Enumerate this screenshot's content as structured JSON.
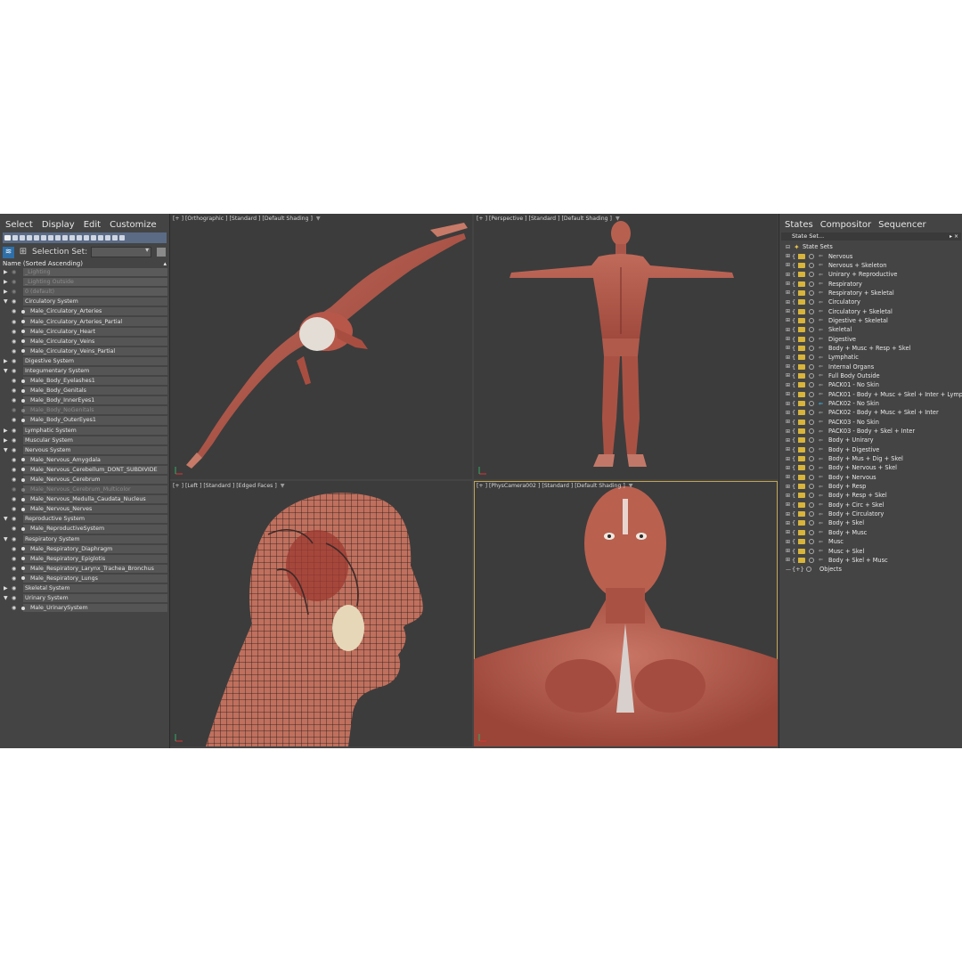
{
  "scene_explorer": {
    "menu": [
      "Select",
      "Display",
      "Edit",
      "Customize"
    ],
    "selection_set_label": "Selection Set:",
    "column_header": "Name (Sorted Ascending)",
    "rows": [
      {
        "label": "_Lighting",
        "kind": "layer",
        "dim": true
      },
      {
        "label": "_Lighting Outside",
        "kind": "layer",
        "dim": true
      },
      {
        "label": "0 (default)",
        "kind": "layer",
        "dim": true
      },
      {
        "label": "Circulatory System",
        "kind": "top"
      },
      {
        "label": "Male_Circulatory_Arteries",
        "kind": "child"
      },
      {
        "label": "Male_Circulatory_Arteries_Partial",
        "kind": "child"
      },
      {
        "label": "Male_Circulatory_Heart",
        "kind": "child"
      },
      {
        "label": "Male_Circulatory_Veins",
        "kind": "child"
      },
      {
        "label": "Male_Circulatory_Veins_Partial",
        "kind": "child"
      },
      {
        "label": "Digestive System",
        "kind": "top",
        "collapsed": true
      },
      {
        "label": "Integumentary System",
        "kind": "top"
      },
      {
        "label": "Male_Body_Eyelashes1",
        "kind": "child"
      },
      {
        "label": "Male_Body_Genitals",
        "kind": "child"
      },
      {
        "label": "Male_Body_InnerEyes1",
        "kind": "child"
      },
      {
        "label": "Male_Body_NoGenitals",
        "kind": "child",
        "dim": true
      },
      {
        "label": "Male_Body_OuterEyes1",
        "kind": "child"
      },
      {
        "label": "Lymphatic System",
        "kind": "top",
        "collapsed": true
      },
      {
        "label": "Muscular System",
        "kind": "top",
        "collapsed": true
      },
      {
        "label": "Nervous System",
        "kind": "top"
      },
      {
        "label": "Male_Nervous_Amygdala",
        "kind": "child"
      },
      {
        "label": "Male_Nervous_Cerebellum_DONT_SUBDIVIDE",
        "kind": "child"
      },
      {
        "label": "Male_Nervous_Cerebrum",
        "kind": "child"
      },
      {
        "label": "Male_Nervous_Cerebrum_Multicolor",
        "kind": "child",
        "dim": true
      },
      {
        "label": "Male_Nervous_Medulla_Caudata_Nucleus",
        "kind": "child"
      },
      {
        "label": "Male_Nervous_Nerves",
        "kind": "child"
      },
      {
        "label": "Reproductive System",
        "kind": "top"
      },
      {
        "label": "Male_ReproductiveSystem",
        "kind": "child"
      },
      {
        "label": "Respiratory System",
        "kind": "top"
      },
      {
        "label": "Male_Respiratory_Diaphragm",
        "kind": "child"
      },
      {
        "label": "Male_Respiratory_Epiglotis",
        "kind": "child"
      },
      {
        "label": "Male_Respiratory_Larynx_Trachea_Bronchus",
        "kind": "child"
      },
      {
        "label": "Male_Respiratory_Lungs",
        "kind": "child"
      },
      {
        "label": "Skeletal System",
        "kind": "top",
        "collapsed": true
      },
      {
        "label": "Urinary System",
        "kind": "top"
      },
      {
        "label": "Male_UrinarySystem",
        "kind": "child"
      }
    ]
  },
  "viewports": {
    "top_left": "[+ ] [Orthographic ]  [Standard ]  [Default Shading ]",
    "top_right": "[+ ] [Perspective ]  [Standard ]  [Default Shading ]",
    "bottom_left": "[+ ] [Left ]  [Standard ]  [Edged Faces ]",
    "bottom_right": "[+ ] [PhysCamera002 ]  [Standard ]  [Default Shading ]"
  },
  "state_sets_panel": {
    "menu": [
      "States",
      "Compositor",
      "Sequencer"
    ],
    "title": "State Set...",
    "root_label": "State Sets",
    "active_index": 16,
    "states": [
      "Nervous",
      "Nervous + Skeleton",
      "Unirary + Reproductive",
      "Respiratory",
      "Respiratory + Skeletal",
      "Circulatory",
      "Circulatory + Skeletal",
      "Digestive + Skeletal",
      "Skeletal",
      "Digestive",
      "Body + Musc + Resp + Skel",
      "Lymphatic",
      "Internal Organs",
      "Full Body Outside",
      "PACK01 - No Skin",
      "PACK01 - Body + Musc + Skel + Inter + Lymp",
      "PACK02 - No Skin",
      "PACK02 - Body + Musc + Skel + Inter",
      "PACK03 - No Skin",
      "PACK03 - Body + Skel + Inter",
      "Body + Unirary",
      "Body + Digestive",
      "Body + Mus + Dig + Skel",
      "Body + Nervous + Skel",
      "Body + Nervous",
      "Body + Resp",
      "Body + Resp + Skel",
      "Body + Circ + Skel",
      "Body + Circulatory",
      "Body + Skel",
      "Body + Musc",
      "Musc",
      "Musc + Skel",
      "Body + Skel + Musc"
    ],
    "objects_label": "Objects"
  },
  "colors": {
    "background": "#444444",
    "viewport": "#3c3c3c",
    "muscle": "#b85a4c",
    "active_outline": "#c0a454",
    "accent": "#3fc6ff"
  }
}
